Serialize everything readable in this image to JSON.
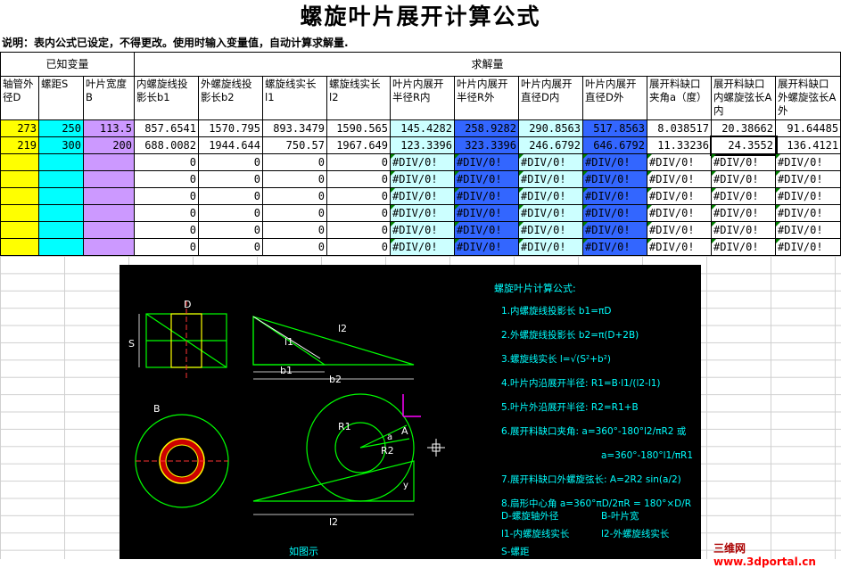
{
  "title": "螺旋叶片展开计算公式",
  "note": "说明：表内公式已设定，不得更改。使用时输入变量值，自动计算求解量.",
  "groups": {
    "known": "已知变量",
    "solve": "求解量"
  },
  "headers": [
    "轴管外径D",
    "螺距S",
    "叶片宽度B",
    "内螺旋线投影长b1",
    "外螺旋线投影长b2",
    "螺旋线实长l1",
    "螺旋线实长l2",
    "叶片内展开半径R内",
    "叶片内展开半径R外",
    "叶片内展开直径D内",
    "叶片内展开直径D外",
    "展开料缺口夹角a（度）",
    "展开料缺口内螺旋弦长A内",
    "展开料缺口外螺旋弦长A外"
  ],
  "rows": [
    [
      "273",
      "250",
      "113.5",
      "857.6541",
      "1570.795",
      "893.3479",
      "1590.565",
      "145.4282",
      "258.9282",
      "290.8563",
      "517.8563",
      "8.038517",
      "20.38662",
      "91.64485"
    ],
    [
      "219",
      "300",
      "200",
      "688.0082",
      "1944.644",
      "750.57",
      "1967.649",
      "123.3396",
      "323.3396",
      "246.6792",
      "646.6792",
      "11.33236",
      "24.3552",
      "136.4121"
    ],
    [
      "",
      "",
      "",
      "0",
      "0",
      "0",
      "0",
      "#DIV/0!",
      "#DIV/0!",
      "#DIV/0!",
      "#DIV/0!",
      "#DIV/0!",
      "#DIV/0!",
      "#DIV/0!"
    ],
    [
      "",
      "",
      "",
      "0",
      "0",
      "0",
      "0",
      "#DIV/0!",
      "#DIV/0!",
      "#DIV/0!",
      "#DIV/0!",
      "#DIV/0!",
      "#DIV/0!",
      "#DIV/0!"
    ],
    [
      "",
      "",
      "",
      "0",
      "0",
      "0",
      "0",
      "#DIV/0!",
      "#DIV/0!",
      "#DIV/0!",
      "#DIV/0!",
      "#DIV/0!",
      "#DIV/0!",
      "#DIV/0!"
    ],
    [
      "",
      "",
      "",
      "0",
      "0",
      "0",
      "0",
      "#DIV/0!",
      "#DIV/0!",
      "#DIV/0!",
      "#DIV/0!",
      "#DIV/0!",
      "#DIV/0!",
      "#DIV/0!"
    ],
    [
      "",
      "",
      "",
      "0",
      "0",
      "0",
      "0",
      "#DIV/0!",
      "#DIV/0!",
      "#DIV/0!",
      "#DIV/0!",
      "#DIV/0!",
      "#DIV/0!",
      "#DIV/0!"
    ],
    [
      "",
      "",
      "",
      "0",
      "0",
      "0",
      "0",
      "#DIV/0!",
      "#DIV/0!",
      "#DIV/0!",
      "#DIV/0!",
      "#DIV/0!",
      "#DIV/0!",
      "#DIV/0!"
    ]
  ],
  "drawing": {
    "labels": {
      "D": "D",
      "S": "S",
      "l1": "l1",
      "l2": "l2",
      "b1": "b1",
      "b2": "b2",
      "B": "B",
      "R1": "R1",
      "R2": "R2",
      "A": "A",
      "a": "a",
      "l2b": "l2",
      "y": "y",
      "caption": "如图示"
    },
    "formula_title": "螺旋叶片计算公式:",
    "formulas": [
      "1.内螺旋线投影长    b1=πD",
      "2.外螺旋线投影长    b2=π(D+2B)",
      "3.螺旋线实长        l=√(S²+b²)",
      "4.叶片内沿展开半径: R1=B·l1/(l2-l1)",
      "5.叶片外沿展开半径: R2=R1+B",
      "6.展开料缺口夹角:   a=360°-180°l2/πR2  或",
      "a=360°-180°l1/πR1",
      "7.展开料缺口外螺旋弦长: A=2R2 sin(a/2)",
      "8.扇形中心角   a=360°πD/2πR = 180°×D/R"
    ],
    "legend": [
      "D-螺旋轴外径",
      "B-叶片宽",
      "l1-内螺旋线实长",
      "l2-外螺旋线实长",
      "S-螺距"
    ]
  },
  "watermark": {
    "brand": "三维网",
    "url": "www.3dportal.cn"
  }
}
